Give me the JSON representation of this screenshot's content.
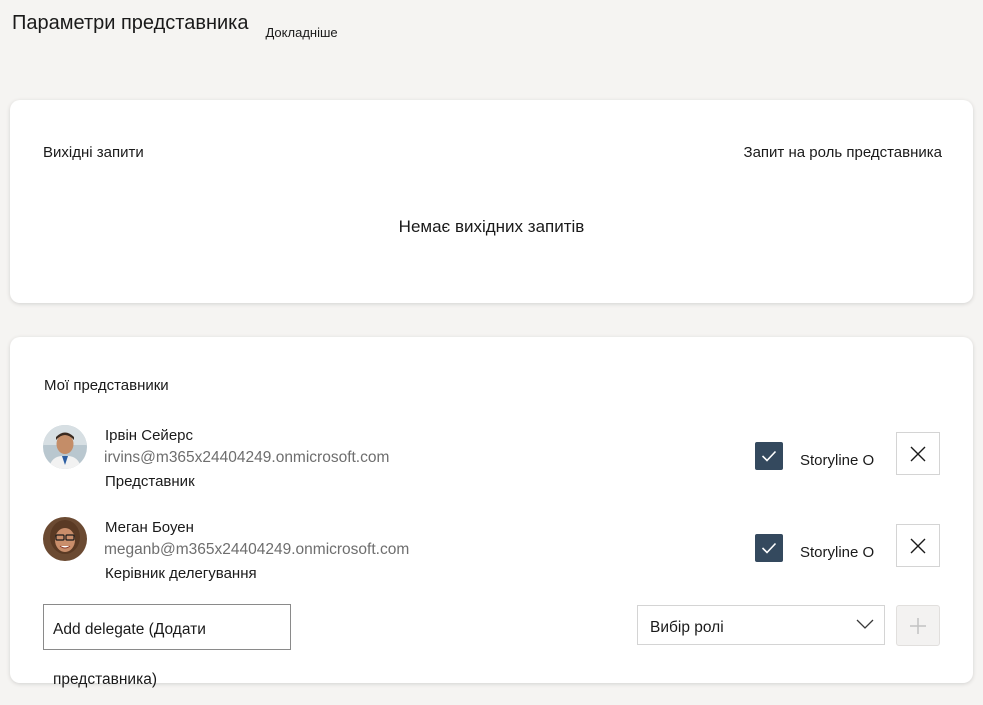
{
  "header": {
    "title": "Параметри представника",
    "learn_more": "Докладніше"
  },
  "outgoing": {
    "title": "Вихідні запити",
    "request_role_link": "Запит на роль представника",
    "empty_message": "Немає вихідних запитів"
  },
  "delegates": {
    "title": "Мої представники",
    "items": [
      {
        "name": "Ірвін Сейерс",
        "email": "irvins@m365x24404249.onmicrosoft.com",
        "role": "Представник",
        "checkbox_checked": true,
        "checkbox_label": "Storyline O"
      },
      {
        "name": "Меган Боуен",
        "email": "meganb@m365x24404249.onmicrosoft.com",
        "role": "Керівник делегування",
        "checkbox_checked": true,
        "checkbox_label": "Storyline O"
      }
    ],
    "add_delegate_label": "Add delegate (Додати представника)",
    "role_select_value": "Вибір ролі"
  },
  "icons": {
    "checkmark": "checkmark-icon",
    "close": "close-icon",
    "chevron": "chevron-down-icon",
    "add": "plus-icon"
  },
  "colors": {
    "checkbox_fill": "#34495e",
    "background": "#f5f4f2",
    "card": "#ffffff",
    "secondary_text": "#6e6e6e"
  }
}
